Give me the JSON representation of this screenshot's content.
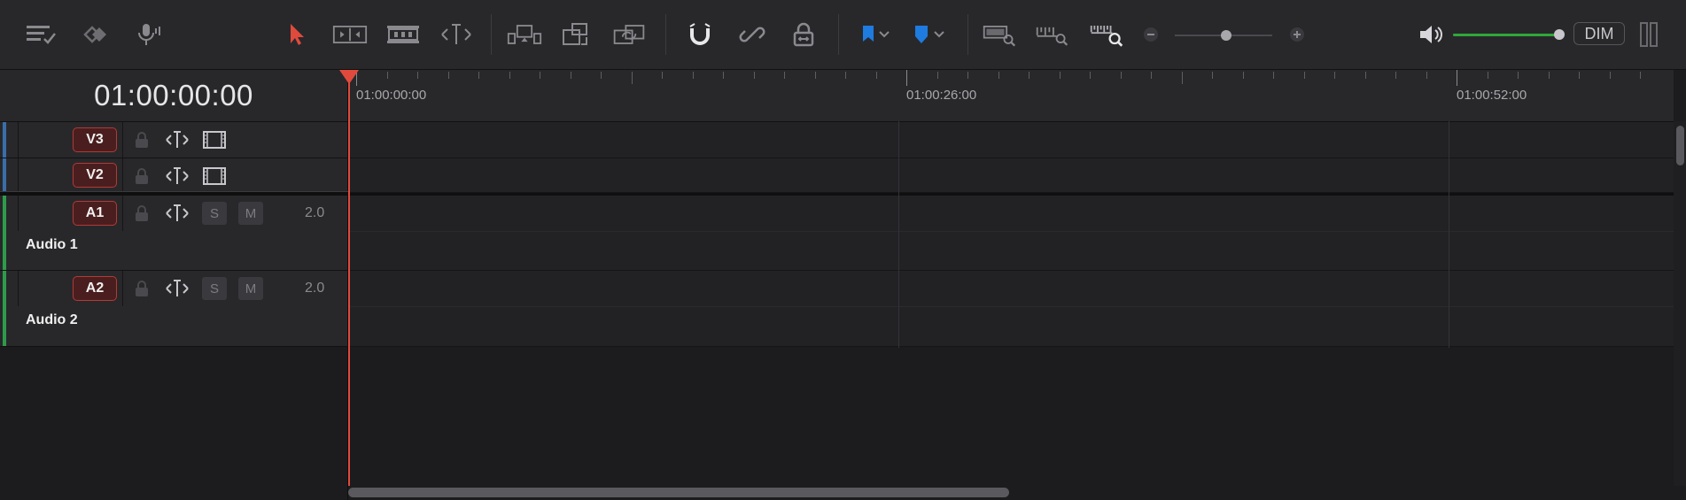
{
  "toolbar": {
    "icons": [
      "timeline-view-options-icon",
      "stacked-timelines-icon",
      "voiceover-mic-icon",
      "selection-arrow-icon",
      "trim-edit-icon",
      "dynamic-trim-icon",
      "blade-icon",
      "insert-clip-icon",
      "overwrite-clip-icon",
      "replace-clip-icon",
      "snapping-magnet-icon",
      "linked-selection-icon",
      "position-lock-icon",
      "flag-icon",
      "marker-icon",
      "zoom-full-icon",
      "zoom-detail-icon",
      "zoom-custom-icon",
      "zoom-out-icon",
      "zoom-in-icon",
      "speaker-icon"
    ],
    "accent": "#1e7be0",
    "tool_active": "#e04a3c",
    "dim_label": "DIM",
    "zoom_level": 0.53,
    "volume_level": 1.0
  },
  "timecode": "01:00:00:00",
  "ruler": {
    "labels": [
      "01:00:00:00",
      "01:00:26:00",
      "01:00:52:00"
    ]
  },
  "tracks": [
    {
      "id": "V3",
      "kind": "video",
      "color": "#3a6ea8"
    },
    {
      "id": "V2",
      "kind": "video",
      "color": "#3a6ea8"
    },
    {
      "id": "A1",
      "kind": "audio",
      "name": "Audio 1",
      "channels": "2.0",
      "solo": "S",
      "mute": "M",
      "color": "#2f9b4a"
    },
    {
      "id": "A2",
      "kind": "audio",
      "name": "Audio 2",
      "channels": "2.0",
      "solo": "S",
      "mute": "M",
      "color": "#2f9b4a"
    }
  ]
}
